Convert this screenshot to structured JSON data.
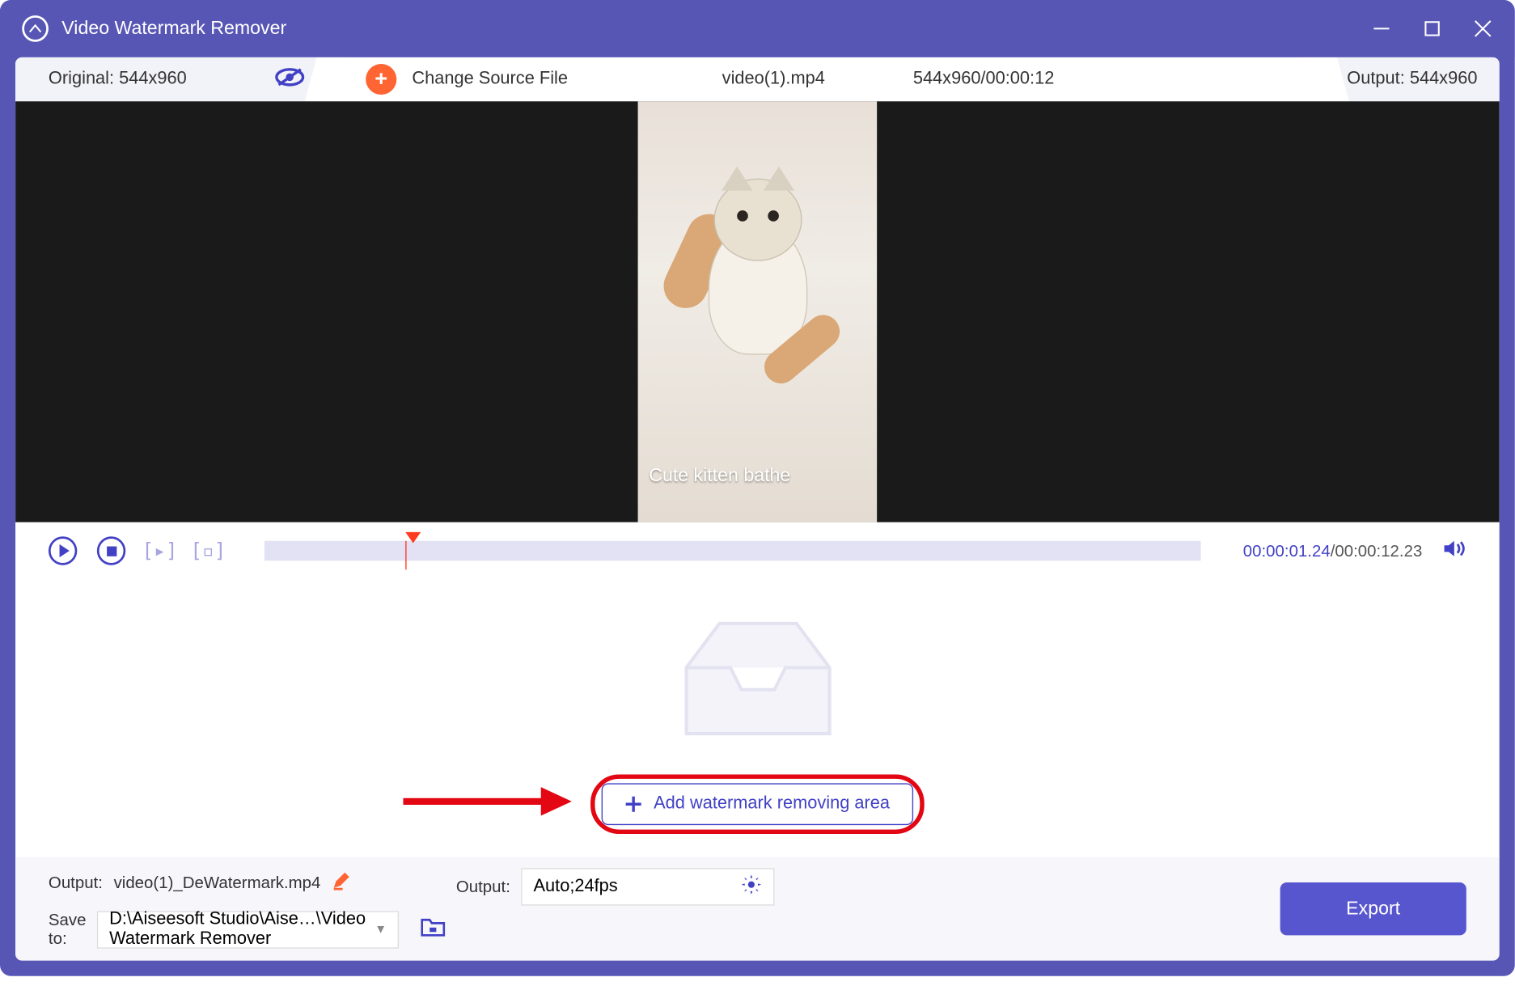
{
  "title": "Video Watermark Remover",
  "topbar": {
    "original_label": "Original: 544x960",
    "change_source": "Change Source File",
    "filename": "video(1).mp4",
    "dims_duration": "544x960/00:00:12",
    "output_label": "Output: 544x960"
  },
  "video": {
    "caption": "Cute kitten bathe"
  },
  "playback": {
    "current_time": "00:00:01.24",
    "total_time": "/00:00:12.23"
  },
  "add_button": "Add watermark removing area",
  "bottom": {
    "output_label": "Output:",
    "output_filename": "video(1)_DeWatermark.mp4",
    "output_settings_label": "Output:",
    "output_settings_value": "Auto;24fps",
    "save_to_label": "Save to:",
    "save_path": "D:\\Aiseesoft Studio\\Aise…\\Video Watermark Remover",
    "export": "Export"
  }
}
